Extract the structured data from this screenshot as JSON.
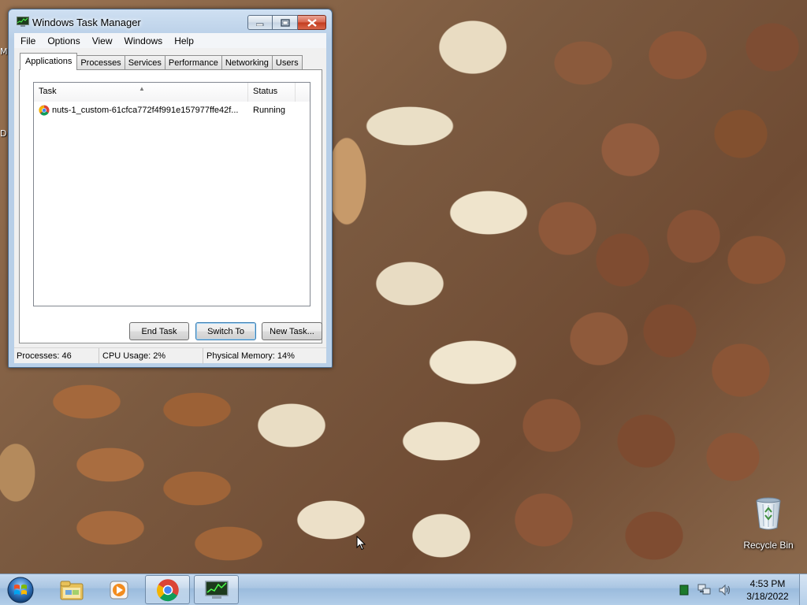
{
  "desktop": {
    "edge_labels": [
      "M",
      "D"
    ],
    "recycle_bin_label": "Recycle Bin"
  },
  "window": {
    "title": "Windows Task Manager",
    "menu": [
      "File",
      "Options",
      "View",
      "Windows",
      "Help"
    ],
    "tabs": [
      "Applications",
      "Processes",
      "Services",
      "Performance",
      "Networking",
      "Users"
    ],
    "active_tab": "Applications",
    "task_list": {
      "columns": [
        "Task",
        "Status"
      ],
      "rows": [
        {
          "task": "nuts-1_custom-61cfca772f4f991e157977ffe42f...",
          "status": "Running",
          "icon": "chrome-icon"
        }
      ]
    },
    "buttons": {
      "end_task": "End Task",
      "switch_to": "Switch To",
      "new_task": "New Task..."
    },
    "statusbar": {
      "processes": "Processes: 46",
      "cpu": "CPU Usage: 2%",
      "memory": "Physical Memory: 14%"
    }
  },
  "taskbar": {
    "pinned": [
      "windows-explorer-icon",
      "media-player-icon",
      "chrome-icon",
      "task-manager-icon"
    ],
    "tray_icons": [
      "network-activity-icon",
      "network-icon",
      "volume-icon"
    ],
    "clock": {
      "time": "4:53 PM",
      "date": "3/18/2022"
    }
  },
  "colors": {
    "taskbar_top": "#c5d9ee",
    "window_frame": "#b9d0e8",
    "close_button": "#c23b1e",
    "chrome_red": "#db4437",
    "chrome_green": "#0f9d58",
    "chrome_yellow": "#f4b400",
    "chrome_blue": "#4285f4"
  }
}
